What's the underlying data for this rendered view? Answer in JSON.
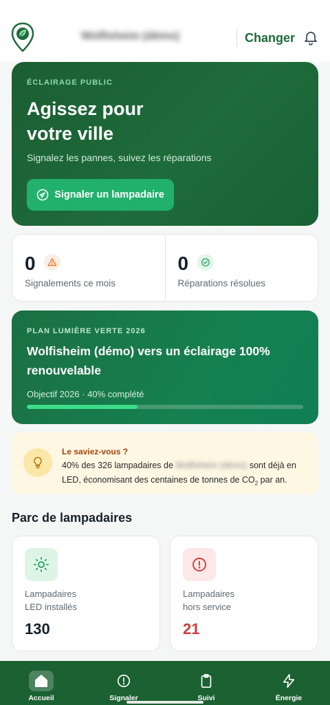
{
  "header": {
    "city_name": "Wolfisheim (démo)",
    "change_label": "Changer"
  },
  "hero": {
    "kicker": "ÉCLAIRAGE PUBLIC",
    "title_line1": "Agissez pour",
    "title_line2": "votre ville",
    "subtitle": "Signalez les pannes, suivez les réparations",
    "button_label": "Signaler un lampadaire"
  },
  "stats": [
    {
      "value": "0",
      "label": "Signalements ce mois",
      "icon": "warning-icon"
    },
    {
      "value": "0",
      "label": "Réparations résolues",
      "icon": "check-circle-icon"
    }
  ],
  "plan": {
    "kicker": "PLAN LUMIÈRE VERTE 2026",
    "title": "Wolfisheim (démo) vers un éclairage 100% renouvelable",
    "objective": "Objectif 2026 · 40% complété",
    "progress_percent": 40
  },
  "tip": {
    "question": "Le saviez-vous ?",
    "text_before": "40% des 326 lampadaires de ",
    "city": "Wolfisheim (démo)",
    "text_after": " sont déjà en LED, économisant des centaines de tonnes de CO",
    "co2_sub": "2",
    "text_end": " par an."
  },
  "parc": {
    "title": "Parc de lampadaires",
    "cards": [
      {
        "line1": "Lampadaires",
        "line2": "LED installés",
        "value": "130",
        "icon": "sun-icon"
      },
      {
        "line1": "Lampadaires",
        "line2": "hors service",
        "value": "21",
        "icon": "alert-circle-icon"
      }
    ]
  },
  "nav": [
    {
      "label": "Accueil",
      "icon": "home-icon",
      "active": true
    },
    {
      "label": "Signaler",
      "icon": "alert-circle-icon",
      "active": false
    },
    {
      "label": "Suivi",
      "icon": "clipboard-icon",
      "active": false
    },
    {
      "label": "Énergie",
      "icon": "bolt-icon",
      "active": false
    }
  ],
  "colors": {
    "primary": "#1b6131",
    "accent": "#22b06d",
    "danger": "#d13b3b",
    "tip_bg": "#fdf7e3"
  }
}
